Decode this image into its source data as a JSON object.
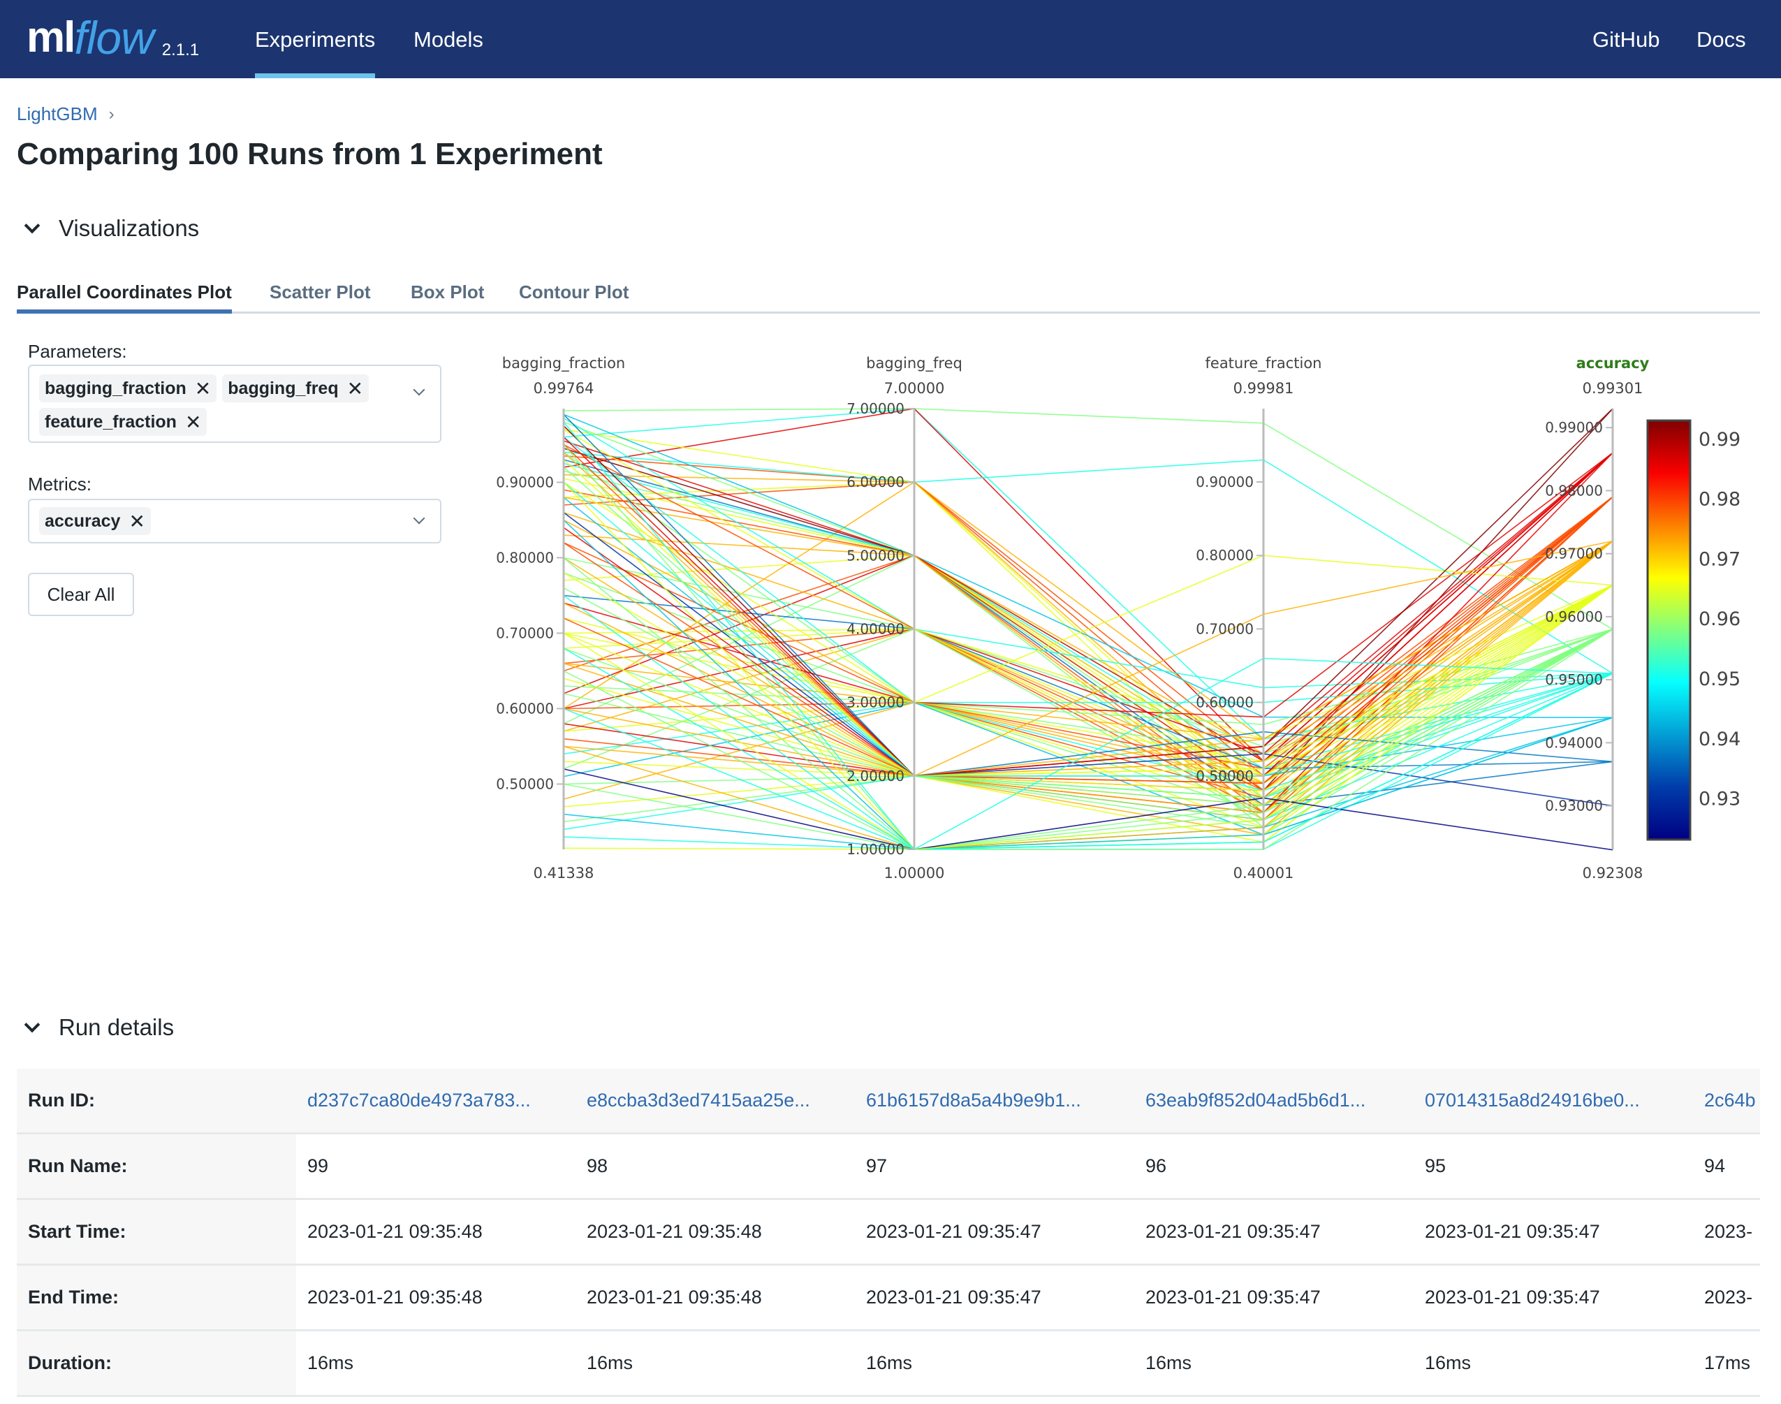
{
  "header": {
    "logo_ml": "ml",
    "logo_flow": "flow",
    "version": "2.1.1",
    "nav": [
      {
        "label": "Experiments",
        "active": true
      },
      {
        "label": "Models",
        "active": false
      }
    ],
    "right_links": [
      {
        "label": "GitHub"
      },
      {
        "label": "Docs"
      }
    ],
    "colors": {
      "background": "#1c3570",
      "active_indicator": "#6dc3ea",
      "logo_accent": "#43a2e8"
    }
  },
  "breadcrumb": {
    "items": [
      "LightGBM"
    ],
    "separator": "›"
  },
  "page_title": "Comparing 100 Runs from 1 Experiment",
  "visualizations": {
    "section_title": "Visualizations",
    "tabs": [
      {
        "label": "Parallel Coordinates Plot",
        "active": true
      },
      {
        "label": "Scatter Plot",
        "active": false
      },
      {
        "label": "Box Plot",
        "active": false
      },
      {
        "label": "Contour Plot",
        "active": false
      }
    ],
    "parameters_label": "Parameters:",
    "parameters_selected": [
      "bagging_fraction",
      "bagging_freq",
      "feature_fraction"
    ],
    "metrics_label": "Metrics:",
    "metrics_selected": [
      "accuracy"
    ],
    "clear_all_label": "Clear All",
    "remove_glyph": "✕"
  },
  "chart_data": {
    "type": "parallel_coordinates",
    "colorscale": "Jet",
    "color_by": "accuracy",
    "axes": [
      {
        "name": "bagging_fraction",
        "range": [
          0.41338,
          0.99764
        ],
        "range_labels": [
          "0.99764",
          "0.41338"
        ],
        "ticks": [
          0.5,
          0.6,
          0.7,
          0.8,
          0.9
        ],
        "tick_labels": [
          "0.50000",
          "0.60000",
          "0.70000",
          "0.80000",
          "0.90000"
        ]
      },
      {
        "name": "bagging_freq",
        "range": [
          1,
          7
        ],
        "range_labels": [
          "7.00000",
          "1.00000"
        ],
        "ticks": [
          1,
          2,
          3,
          4,
          5,
          6,
          7
        ],
        "tick_labels": [
          "1.00000",
          "2.00000",
          "3.00000",
          "4.00000",
          "5.00000",
          "6.00000",
          "7.00000"
        ]
      },
      {
        "name": "feature_fraction",
        "range": [
          0.40001,
          0.99981
        ],
        "range_labels": [
          "0.99981",
          "0.40001"
        ],
        "ticks": [
          0.5,
          0.6,
          0.7,
          0.8,
          0.9
        ],
        "tick_labels": [
          "0.50000",
          "0.60000",
          "0.70000",
          "0.80000",
          "0.90000"
        ]
      },
      {
        "name": "accuracy",
        "range": [
          0.92308,
          0.99301
        ],
        "range_labels": [
          "0.99301",
          "0.92308"
        ],
        "ticks": [
          0.93,
          0.94,
          0.95,
          0.96,
          0.97,
          0.98,
          0.99
        ],
        "tick_labels": [
          "0.93000",
          "0.94000",
          "0.95000",
          "0.96000",
          "0.97000",
          "0.98000",
          "0.99000"
        ],
        "highlight": true
      }
    ],
    "colorbar": {
      "ticks": [
        0.93,
        0.94,
        0.95,
        0.96,
        0.97,
        0.98,
        0.99
      ],
      "tick_labels": [
        "0.93",
        "0.94",
        "0.95",
        "0.96",
        "0.97",
        "0.98",
        "0.99"
      ],
      "range": [
        0.92308,
        0.99301
      ]
    },
    "accuracy_levels": [
      0.92308,
      0.93007,
      0.93706,
      0.94406,
      0.95105,
      0.95804,
      0.96503,
      0.97203,
      0.97902,
      0.98601,
      0.99301
    ],
    "runs": [
      [
        0.96,
        7,
        0.55,
        0.951
      ],
      [
        0.995,
        7,
        0.98,
        0.958
      ],
      [
        0.92,
        7,
        0.52,
        0.986
      ],
      [
        0.97,
        6,
        0.47,
        0.965
      ],
      [
        0.935,
        6,
        0.5,
        0.979
      ],
      [
        0.94,
        6,
        0.93,
        0.951
      ],
      [
        0.91,
        6,
        0.55,
        0.972
      ],
      [
        0.88,
        6,
        0.45,
        0.965
      ],
      [
        0.87,
        6,
        0.52,
        0.979
      ],
      [
        0.6,
        6,
        0.48,
        0.972
      ],
      [
        0.99,
        5,
        0.58,
        0.944
      ],
      [
        0.98,
        5,
        0.52,
        0.958
      ],
      [
        0.955,
        5,
        0.5,
        0.986
      ],
      [
        0.945,
        5,
        0.48,
        0.993
      ],
      [
        0.93,
        5,
        0.46,
        0.937
      ],
      [
        0.925,
        5,
        0.51,
        0.951
      ],
      [
        0.915,
        5,
        0.47,
        0.958
      ],
      [
        0.905,
        5,
        0.49,
        0.965
      ],
      [
        0.89,
        5,
        0.45,
        0.979
      ],
      [
        0.88,
        5,
        0.53,
        0.972
      ],
      [
        0.77,
        5,
        0.5,
        0.965
      ],
      [
        0.65,
        5,
        0.48,
        0.979
      ],
      [
        0.62,
        5,
        0.52,
        0.986
      ],
      [
        0.58,
        5,
        0.43,
        0.958
      ],
      [
        0.83,
        5,
        0.44,
        0.972
      ],
      [
        0.985,
        4,
        0.62,
        0.951
      ],
      [
        0.97,
        4,
        0.5,
        0.965
      ],
      [
        0.95,
        4,
        0.48,
        0.979
      ],
      [
        0.86,
        4,
        0.46,
        0.972
      ],
      [
        0.8,
        4,
        0.54,
        0.958
      ],
      [
        0.75,
        4,
        0.51,
        0.937
      ],
      [
        0.7,
        4,
        0.47,
        0.965
      ],
      [
        0.66,
        4,
        0.45,
        0.979
      ],
      [
        0.6,
        4,
        0.53,
        0.986
      ],
      [
        0.57,
        4,
        0.49,
        0.972
      ],
      [
        0.52,
        4,
        0.44,
        0.958
      ],
      [
        0.68,
        4,
        0.55,
        0.965
      ],
      [
        0.96,
        3,
        0.6,
        0.951
      ],
      [
        0.94,
        3,
        0.57,
        0.958
      ],
      [
        0.9,
        3,
        0.52,
        0.965
      ],
      [
        0.85,
        3,
        0.5,
        0.972
      ],
      [
        0.82,
        3,
        0.47,
        0.979
      ],
      [
        0.78,
        3,
        0.45,
        0.958
      ],
      [
        0.74,
        3,
        0.58,
        0.986
      ],
      [
        0.7,
        3,
        0.43,
        0.965
      ],
      [
        0.66,
        3,
        0.49,
        0.972
      ],
      [
        0.63,
        3,
        0.53,
        0.958
      ],
      [
        0.6,
        3,
        0.51,
        0.979
      ],
      [
        0.57,
        3,
        0.46,
        0.965
      ],
      [
        0.54,
        3,
        0.48,
        0.951
      ],
      [
        0.51,
        3,
        0.42,
        0.944
      ],
      [
        0.48,
        3,
        0.55,
        0.972
      ],
      [
        0.72,
        3,
        0.8,
        0.965
      ],
      [
        0.99,
        2,
        0.56,
        0.937
      ],
      [
        0.975,
        2,
        0.54,
        0.993
      ],
      [
        0.96,
        2,
        0.5,
        0.986
      ],
      [
        0.95,
        2,
        0.48,
        0.979
      ],
      [
        0.94,
        2,
        0.46,
        0.972
      ],
      [
        0.93,
        2,
        0.52,
        0.965
      ],
      [
        0.92,
        2,
        0.44,
        0.958
      ],
      [
        0.9,
        2,
        0.47,
        0.951
      ],
      [
        0.88,
        2,
        0.5,
        0.944
      ],
      [
        0.86,
        2,
        0.53,
        0.93
      ],
      [
        0.84,
        2,
        0.45,
        0.986
      ],
      [
        0.82,
        2,
        0.49,
        0.979
      ],
      [
        0.8,
        2,
        0.42,
        0.972
      ],
      [
        0.78,
        2,
        0.51,
        0.965
      ],
      [
        0.76,
        2,
        0.47,
        0.958
      ],
      [
        0.74,
        2,
        0.55,
        0.972
      ],
      [
        0.72,
        2,
        0.44,
        0.979
      ],
      [
        0.7,
        2,
        0.5,
        0.965
      ],
      [
        0.68,
        2,
        0.46,
        0.958
      ],
      [
        0.66,
        2,
        0.52,
        0.972
      ],
      [
        0.64,
        2,
        0.48,
        0.965
      ],
      [
        0.62,
        2,
        0.43,
        0.958
      ],
      [
        0.58,
        2,
        0.54,
        0.986
      ],
      [
        0.56,
        2,
        0.49,
        0.979
      ],
      [
        0.55,
        2,
        0.45,
        0.972
      ],
      [
        0.53,
        2,
        0.41,
        0.965
      ],
      [
        0.5,
        2,
        0.47,
        0.958
      ],
      [
        0.47,
        2,
        0.51,
        0.965
      ],
      [
        0.45,
        2,
        0.44,
        0.958
      ],
      [
        0.44,
        2,
        0.5,
        0.951
      ],
      [
        0.6,
        2,
        0.72,
        0.972
      ],
      [
        0.98,
        1,
        0.44,
        0.951
      ],
      [
        0.95,
        1,
        0.42,
        0.958
      ],
      [
        0.9,
        1,
        0.41,
        0.965
      ],
      [
        0.85,
        1,
        0.43,
        0.944
      ],
      [
        0.8,
        1,
        0.45,
        0.958
      ],
      [
        0.75,
        1,
        0.4,
        0.951
      ],
      [
        0.7,
        1,
        0.42,
        0.965
      ],
      [
        0.65,
        1,
        0.46,
        0.958
      ],
      [
        0.6,
        1,
        0.41,
        0.951
      ],
      [
        0.55,
        1,
        0.43,
        0.972
      ],
      [
        0.52,
        1,
        0.47,
        0.923
      ],
      [
        0.5,
        1,
        0.4,
        0.958
      ],
      [
        0.46,
        1,
        0.42,
        0.944
      ],
      [
        0.43,
        1,
        0.41,
        0.951
      ],
      [
        0.415,
        1,
        0.44,
        0.965
      ],
      [
        0.68,
        1,
        0.66,
        0.951
      ]
    ]
  },
  "run_details": {
    "section_title": "Run details",
    "row_labels": [
      "Run ID:",
      "Run Name:",
      "Start Time:",
      "End Time:",
      "Duration:"
    ],
    "columns": [
      {
        "run_id": "d237c7ca80de4973a783...",
        "run_name": "99",
        "start_time": "2023-01-21 09:35:48",
        "end_time": "2023-01-21 09:35:48",
        "duration": "16ms"
      },
      {
        "run_id": "e8ccba3d3ed7415aa25e...",
        "run_name": "98",
        "start_time": "2023-01-21 09:35:48",
        "end_time": "2023-01-21 09:35:48",
        "duration": "16ms"
      },
      {
        "run_id": "61b6157d8a5a4b9e9b1...",
        "run_name": "97",
        "start_time": "2023-01-21 09:35:47",
        "end_time": "2023-01-21 09:35:47",
        "duration": "16ms"
      },
      {
        "run_id": "63eab9f852d04ad5b6d1...",
        "run_name": "96",
        "start_time": "2023-01-21 09:35:47",
        "end_time": "2023-01-21 09:35:47",
        "duration": "16ms"
      },
      {
        "run_id": "07014315a8d24916be0...",
        "run_name": "95",
        "start_time": "2023-01-21 09:35:47",
        "end_time": "2023-01-21 09:35:47",
        "duration": "16ms"
      },
      {
        "run_id": "2c64b",
        "run_name": "94",
        "start_time": "2023-",
        "end_time": "2023-",
        "duration": "17ms"
      }
    ]
  }
}
